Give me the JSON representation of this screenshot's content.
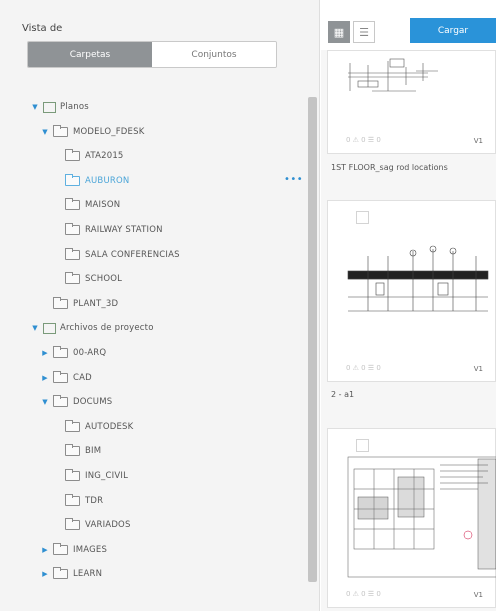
{
  "left_panel": {
    "title": "Vista de",
    "toggle": {
      "active": "Carpetas",
      "inactive": "Conjuntos"
    },
    "tree": [
      {
        "label": "Planos",
        "arrow": "▼",
        "type": "root"
      },
      {
        "label": "MODELO_FDESK",
        "arrow": "▼",
        "type": "folder"
      },
      {
        "label": "ATA2015",
        "arrow": "",
        "type": "folder"
      },
      {
        "label": "AUBURON",
        "arrow": "",
        "type": "folder",
        "selected": true
      },
      {
        "label": "MAISON",
        "arrow": "",
        "type": "folder"
      },
      {
        "label": "RAILWAY STATION",
        "arrow": "",
        "type": "folder"
      },
      {
        "label": "SALA CONFERENCIAS",
        "arrow": "",
        "type": "folder"
      },
      {
        "label": "SCHOOL",
        "arrow": "",
        "type": "folder"
      },
      {
        "label": "PLANT_3D",
        "arrow": "",
        "type": "folder"
      },
      {
        "label": "Archivos de proyecto",
        "arrow": "▼",
        "type": "root"
      },
      {
        "label": "00-ARQ",
        "arrow": "▶",
        "type": "folder"
      },
      {
        "label": "CAD",
        "arrow": "▶",
        "type": "folder"
      },
      {
        "label": "DOCUMS",
        "arrow": "▼",
        "type": "folder"
      },
      {
        "label": "AUTODESK",
        "arrow": "",
        "type": "folder"
      },
      {
        "label": "BIM",
        "arrow": "",
        "type": "folder"
      },
      {
        "label": "ING_CIVIL",
        "arrow": "",
        "type": "folder"
      },
      {
        "label": "TDR",
        "arrow": "",
        "type": "folder"
      },
      {
        "label": "VARIADOS",
        "arrow": "",
        "type": "folder"
      },
      {
        "label": "IMAGES",
        "arrow": "▶",
        "type": "folder"
      },
      {
        "label": "LEARN",
        "arrow": "▶",
        "type": "folder"
      }
    ],
    "more_icon": "more-dots-icon"
  },
  "toolbar": {
    "grid_icon": "grid-view-icon",
    "list_icon": "list-view-icon",
    "upload_label": "Cargar"
  },
  "cards": [
    {
      "caption": "1ST FLOOR_sag rod locations",
      "version": "V1",
      "stats": "0 ⚠ 0 ☰ 0"
    },
    {
      "caption": "2 - a1",
      "version": "V1",
      "stats": "0 ⚠ 0 ☰ 0"
    },
    {
      "caption": "",
      "version": "V1",
      "stats": "0 ⚠ 0 ☰ 0"
    }
  ]
}
